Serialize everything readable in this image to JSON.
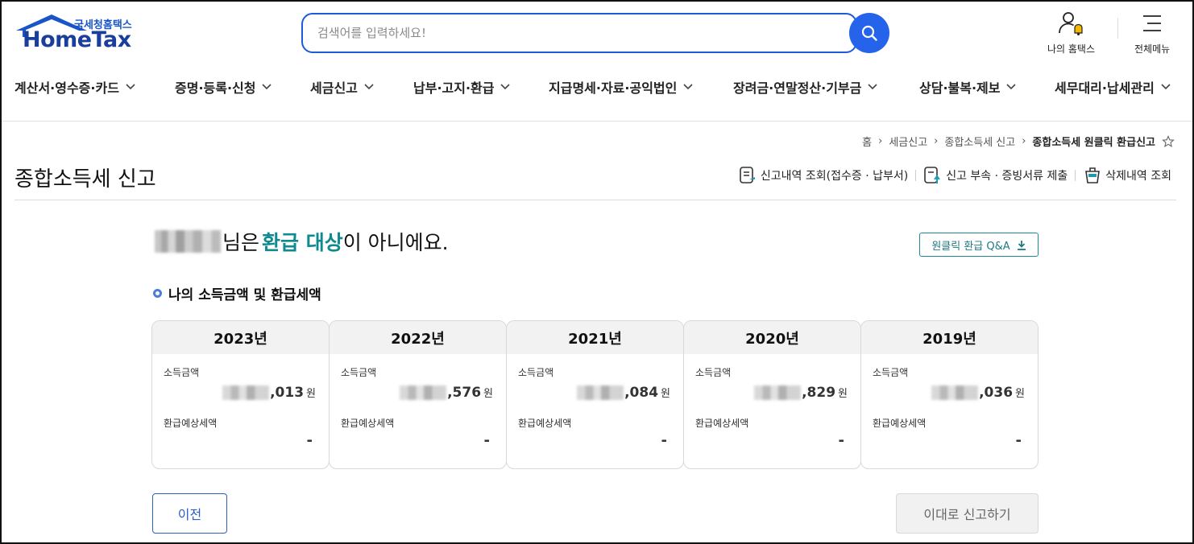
{
  "logo": {
    "sub": "국세청홈택스",
    "main": "HomeTax"
  },
  "search": {
    "placeholder": "검색어를 입력하세요!"
  },
  "util": {
    "my_hometax": "나의 홈택스",
    "all_menu": "전체메뉴"
  },
  "nav": [
    "계산서·영수증·카드",
    "증명·등록·신청",
    "세금신고",
    "납부·고지·환급",
    "지급명세·자료·공익법인",
    "장려금·연말정산·기부금",
    "상담·불복·제보",
    "세무대리·납세관리"
  ],
  "breadcrumb": [
    "홈",
    "세금신고",
    "종합소득세 신고",
    "종합소득세 원클릭 환급신고"
  ],
  "page_title": "종합소득세 신고",
  "actions": {
    "history": "신고내역 조회(접수증 · 납부서)",
    "attach": "신고 부속 · 증빙서류 제출",
    "delete": "삭제내역 조회"
  },
  "result": {
    "suffix1": "님은",
    "highlight": "환급 대상",
    "suffix2": "이 아니에요."
  },
  "qa_button": "원클릭 환급 Q&A",
  "section_title": "나의 소득금액 및 환급세액",
  "labels": {
    "income": "소득금액",
    "refund": "환급예상세액",
    "unit": "원"
  },
  "years": [
    {
      "year": "2023년",
      "income_tail": ",013",
      "refund": "-"
    },
    {
      "year": "2022년",
      "income_tail": ",576",
      "refund": "-"
    },
    {
      "year": "2021년",
      "income_tail": ",084",
      "refund": "-"
    },
    {
      "year": "2020년",
      "income_tail": ",829",
      "refund": "-"
    },
    {
      "year": "2019년",
      "income_tail": ",036",
      "refund": "-"
    }
  ],
  "buttons": {
    "prev": "이전",
    "submit": "이대로 신고하기"
  },
  "colors": {
    "accent_blue": "#2563eb",
    "teal": "#0f8a8f"
  }
}
